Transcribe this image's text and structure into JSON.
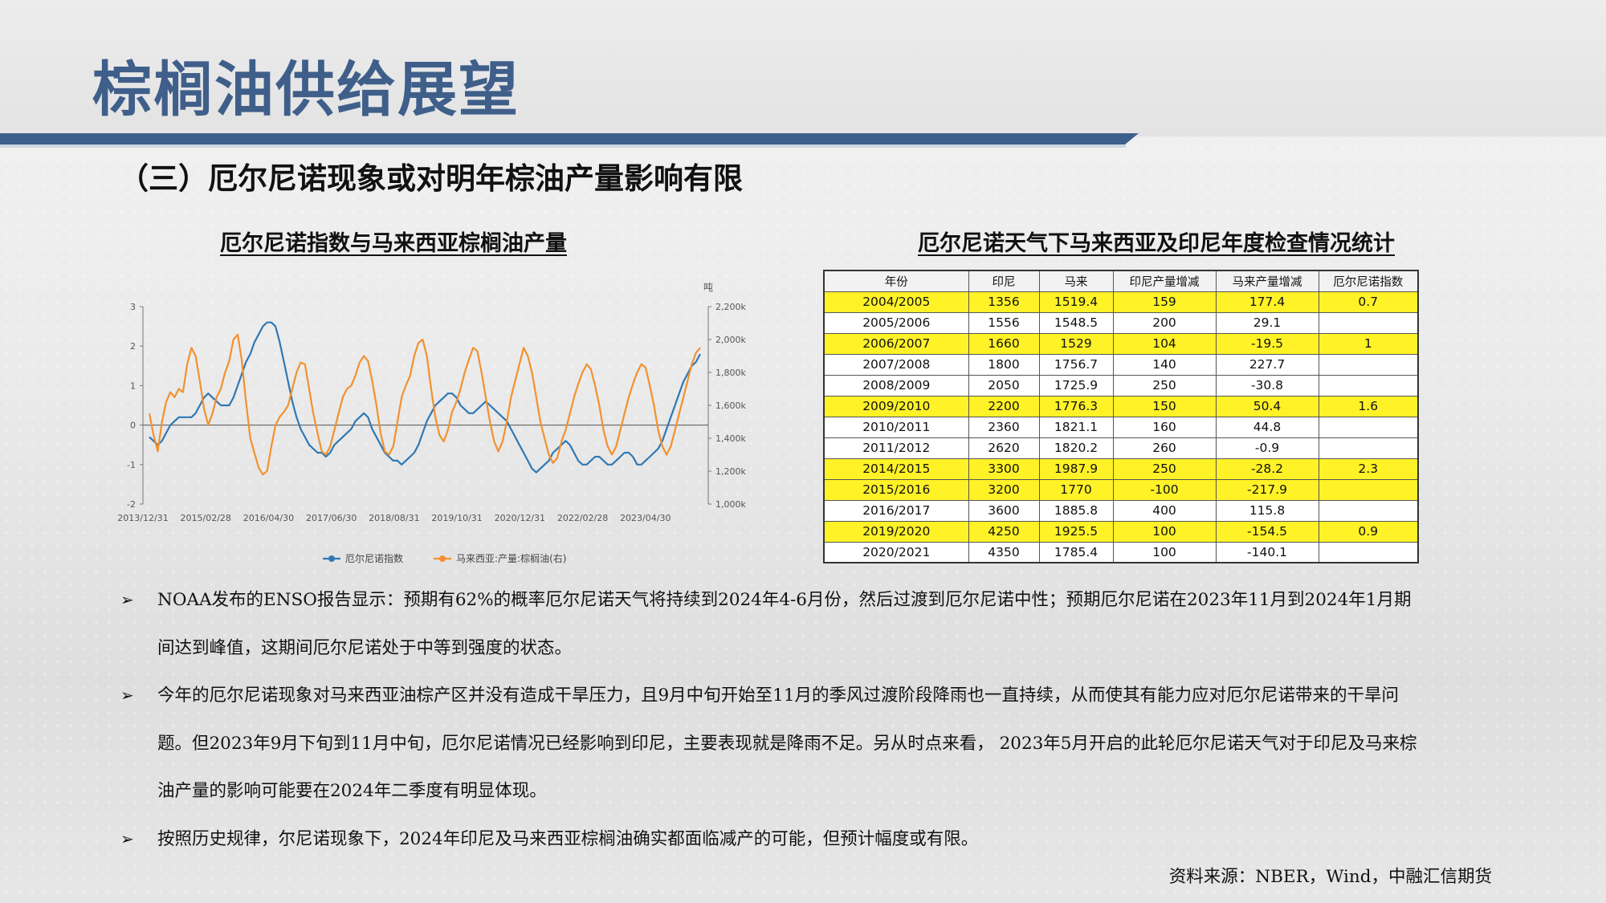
{
  "page_title": "棕榈油供给展望",
  "subtitle": "（三）厄尔尼诺现象或对明年棕油产量影响有限",
  "chart_left_title": "厄尔尼诺指数与马来西亚棕榈油产量",
  "chart_right_title": "厄尔尼诺天气下马来西亚及印尼年度检查情况统计",
  "chart_data": {
    "type": "line",
    "y_left": {
      "ticks": [
        "3",
        "2",
        "1",
        "0",
        "-1",
        "-2"
      ],
      "range": [
        -2,
        3
      ]
    },
    "y_right": {
      "unit": "吨",
      "ticks": [
        "2,200k",
        "2,000k",
        "1,800k",
        "1,600k",
        "1,400k",
        "1,200k",
        "1,000k"
      ],
      "range": [
        1000,
        2200
      ]
    },
    "x_ticks": [
      "2013/12/31",
      "2015/02/28",
      "2016/04/30",
      "2017/06/30",
      "2018/08/31",
      "2019/10/31",
      "2020/12/31",
      "2022/02/28",
      "2023/04/30"
    ],
    "grid": false,
    "legend_position": "bottom",
    "series": [
      {
        "name": "厄尔尼诺指数",
        "axis": "left",
        "color": "#2f78b4",
        "values": [
          -0.3,
          -0.4,
          -0.5,
          -0.4,
          -0.2,
          0,
          0.1,
          0.2,
          0.2,
          0.2,
          0.2,
          0.3,
          0.5,
          0.7,
          0.8,
          0.7,
          0.6,
          0.5,
          0.5,
          0.5,
          0.7,
          1.0,
          1.3,
          1.6,
          1.8,
          2.1,
          2.3,
          2.5,
          2.6,
          2.6,
          2.5,
          2.1,
          1.6,
          1.1,
          0.6,
          0.2,
          -0.1,
          -0.3,
          -0.5,
          -0.6,
          -0.7,
          -0.7,
          -0.8,
          -0.7,
          -0.5,
          -0.4,
          -0.3,
          -0.2,
          -0.1,
          0.1,
          0.2,
          0.3,
          0.2,
          -0.1,
          -0.3,
          -0.5,
          -0.7,
          -0.8,
          -0.9,
          -0.9,
          -1.0,
          -0.9,
          -0.8,
          -0.7,
          -0.5,
          -0.2,
          0.1,
          0.3,
          0.5,
          0.6,
          0.7,
          0.8,
          0.8,
          0.7,
          0.5,
          0.4,
          0.3,
          0.3,
          0.4,
          0.5,
          0.6,
          0.5,
          0.4,
          0.3,
          0.2,
          0.1,
          -0.1,
          -0.3,
          -0.5,
          -0.7,
          -0.9,
          -1.1,
          -1.2,
          -1.1,
          -1.0,
          -0.9,
          -0.7,
          -0.6,
          -0.5,
          -0.4,
          -0.5,
          -0.7,
          -0.9,
          -1.0,
          -1.0,
          -0.9,
          -0.8,
          -0.8,
          -0.9,
          -1.0,
          -1.0,
          -0.9,
          -0.8,
          -0.7,
          -0.7,
          -0.8,
          -1.0,
          -1.0,
          -0.9,
          -0.8,
          -0.7,
          -0.6,
          -0.4,
          -0.1,
          0.2,
          0.5,
          0.8,
          1.1,
          1.3,
          1.5,
          1.6,
          1.8
        ]
      },
      {
        "name": "马来西亚:产量:棕榈油(右)",
        "axis": "right",
        "color": "#f2912f",
        "values": [
          1550,
          1420,
          1320,
          1500,
          1620,
          1680,
          1650,
          1700,
          1680,
          1850,
          1950,
          1900,
          1750,
          1580,
          1480,
          1550,
          1650,
          1700,
          1800,
          1870,
          2000,
          2030,
          1870,
          1620,
          1400,
          1310,
          1220,
          1180,
          1200,
          1350,
          1480,
          1530,
          1560,
          1600,
          1700,
          1800,
          1860,
          1850,
          1700,
          1550,
          1430,
          1320,
          1300,
          1350,
          1450,
          1550,
          1650,
          1700,
          1720,
          1780,
          1860,
          1900,
          1870,
          1750,
          1600,
          1430,
          1320,
          1300,
          1350,
          1500,
          1650,
          1720,
          1780,
          1900,
          1980,
          2000,
          1900,
          1700,
          1530,
          1420,
          1380,
          1450,
          1560,
          1620,
          1700,
          1800,
          1880,
          1950,
          1930,
          1800,
          1650,
          1500,
          1380,
          1320,
          1380,
          1500,
          1650,
          1750,
          1850,
          1950,
          1900,
          1800,
          1650,
          1500,
          1400,
          1300,
          1250,
          1280,
          1380,
          1450,
          1550,
          1650,
          1730,
          1800,
          1850,
          1820,
          1720,
          1600,
          1450,
          1350,
          1300,
          1350,
          1450,
          1550,
          1650,
          1730,
          1800,
          1850,
          1830,
          1720,
          1600,
          1450,
          1350,
          1300,
          1350,
          1450,
          1550,
          1650,
          1750,
          1850,
          1920,
          1950
        ]
      }
    ]
  },
  "table": {
    "headers": [
      "年份",
      "印尼",
      "马来",
      "印尼产量增减",
      "马来产量增减",
      "厄尔尼诺指数"
    ],
    "rows": [
      {
        "highlight": true,
        "cells": [
          "2004/2005",
          "1356",
          "1519.4",
          "159",
          "177.4",
          "0.7"
        ]
      },
      {
        "highlight": false,
        "cells": [
          "2005/2006",
          "1556",
          "1548.5",
          "200",
          "29.1",
          ""
        ]
      },
      {
        "highlight": true,
        "cells": [
          "2006/2007",
          "1660",
          "1529",
          "104",
          "-19.5",
          "1"
        ]
      },
      {
        "highlight": false,
        "cells": [
          "2007/2008",
          "1800",
          "1756.7",
          "140",
          "227.7",
          ""
        ]
      },
      {
        "highlight": false,
        "cells": [
          "2008/2009",
          "2050",
          "1725.9",
          "250",
          "-30.8",
          ""
        ]
      },
      {
        "highlight": true,
        "cells": [
          "2009/2010",
          "2200",
          "1776.3",
          "150",
          "50.4",
          "1.6"
        ]
      },
      {
        "highlight": false,
        "cells": [
          "2010/2011",
          "2360",
          "1821.1",
          "160",
          "44.8",
          ""
        ]
      },
      {
        "highlight": false,
        "cells": [
          "2011/2012",
          "2620",
          "1820.2",
          "260",
          "-0.9",
          ""
        ]
      },
      {
        "highlight": true,
        "cells": [
          "2014/2015",
          "3300",
          "1987.9",
          "250",
          "-28.2",
          "2.3"
        ]
      },
      {
        "highlight": true,
        "cells": [
          "2015/2016",
          "3200",
          "1770",
          "-100",
          "-217.9",
          ""
        ]
      },
      {
        "highlight": false,
        "cells": [
          "2016/2017",
          "3600",
          "1885.8",
          "400",
          "115.8",
          ""
        ]
      },
      {
        "highlight": true,
        "cells": [
          "2019/2020",
          "4250",
          "1925.5",
          "100",
          "-154.5",
          "0.9"
        ]
      },
      {
        "highlight": false,
        "cells": [
          "2020/2021",
          "4350",
          "1785.4",
          "100",
          "-140.1",
          ""
        ]
      }
    ]
  },
  "bullets": [
    "NOAA发布的ENSO报告显示：预期有62%的概率厄尔尼诺天气将持续到2024年4-6月份，然后过渡到厄尔尼诺中性；预期厄尔尼诺在2023年11月到2024年1月期间达到峰值，这期间厄尔尼诺处于中等到强度的状态。",
    "今年的厄尔尼诺现象对马来西亚油棕产区并没有造成干旱压力，且9月中旬开始至11月的季风过渡阶段降雨也一直持续，从而使其有能力应对厄尔尼诺带来的干旱问题。但2023年9月下旬到11月中旬，厄尔尼诺情况已经影响到印尼，主要表现就是降雨不足。另从时点来看， 2023年5月开启的此轮厄尔尼诺天气对于印尼及马来棕油产量的影响可能要在2024年二季度有明显体现。",
    "按照历史规律，尔尼诺现象下，2024年印尼及马来西亚棕榈油确实都面临减产的可能，但预计幅度或有限。"
  ],
  "bullet_marker": "➢",
  "source": "资料来源：NBER，Wind，中融汇信期货"
}
